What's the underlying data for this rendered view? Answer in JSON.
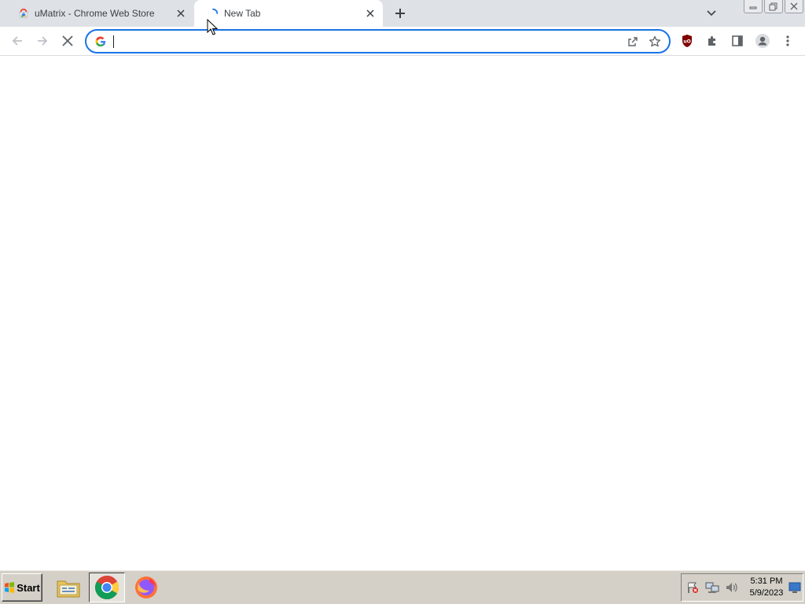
{
  "browser": {
    "tabs": [
      {
        "title": "uMatrix - Chrome Web Store",
        "icon": "chrome-web-store-icon",
        "active": false
      },
      {
        "title": "New Tab",
        "icon": "loading-spinner-icon",
        "active": true
      }
    ],
    "new_tab_icon": "plus-icon",
    "tab_search_icon": "chevron-down-icon",
    "window_controls": [
      "minimize-icon",
      "restore-icon",
      "close-icon"
    ]
  },
  "toolbar": {
    "back_icon": "back-arrow-icon",
    "forward_icon": "forward-arrow-icon",
    "stop_icon": "stop-loading-icon",
    "omnibox": {
      "value": "",
      "search_engine_icon": "google-g-icon",
      "share_icon": "share-icon",
      "bookmark_icon": "star-icon"
    },
    "extensions": [
      "ublock-origin-icon",
      "extensions-puzzle-icon",
      "side-panel-icon",
      "profile-avatar-icon",
      "kebab-menu-icon"
    ]
  },
  "taskbar": {
    "start_label": "Start",
    "apps": [
      "file-explorer-icon",
      "chrome-icon",
      "firefox-icon"
    ],
    "tray_icons": [
      "action-center-flag-icon",
      "network-icon",
      "volume-icon"
    ],
    "clock_time": "5:31 PM",
    "clock_date": "5/9/2023"
  },
  "colors": {
    "tabstrip": "#dee1e6",
    "omnibox_focus": "#1a73e8",
    "taskbar": "#d4d0c8",
    "ublock_red": "#800000"
  }
}
